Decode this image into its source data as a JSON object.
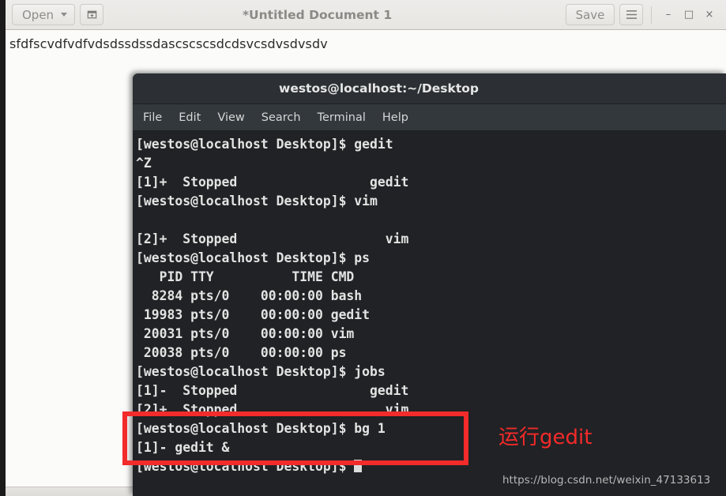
{
  "gedit": {
    "title": "*Untitled Document 1",
    "open_label": "Open",
    "save_label": "Save",
    "new_doc_icon": "new-document-icon",
    "menu_icon": "hamburger-menu-icon",
    "window_controls": {
      "minimize": "–",
      "maximize": "□",
      "close": "×"
    },
    "document_text": "sfdfscvdfvdfvdsdssdssdascscscsdcdsvcsdvsdvsdv"
  },
  "terminal": {
    "title": "westos@localhost:~/Desktop",
    "menu": [
      {
        "label": "File"
      },
      {
        "label": "Edit"
      },
      {
        "label": "View"
      },
      {
        "label": "Search"
      },
      {
        "label": "Terminal"
      },
      {
        "label": "Help"
      }
    ],
    "lines": [
      "[westos@localhost Desktop]$ gedit",
      "^Z",
      "[1]+  Stopped                 gedit",
      "[westos@localhost Desktop]$ vim",
      "",
      "[2]+  Stopped                   vim",
      "[westos@localhost Desktop]$ ps",
      "   PID TTY          TIME CMD",
      "  8284 pts/0    00:00:00 bash",
      " 19983 pts/0    00:00:00 gedit",
      " 20031 pts/0    00:00:00 vim",
      " 20038 pts/0    00:00:00 ps",
      "[westos@localhost Desktop]$ jobs",
      "[1]-  Stopped                 gedit",
      "[2]+  Stopped                   vim",
      "[westos@localhost Desktop]$ bg 1",
      "[1]- gedit &"
    ],
    "prompt": "[westos@localhost Desktop]$ "
  },
  "annotations": {
    "highlight_label": "运行gedit",
    "highlight_color": "#f42a2a",
    "watermark": "https://blog.csdn.net/weixin_47133613"
  }
}
